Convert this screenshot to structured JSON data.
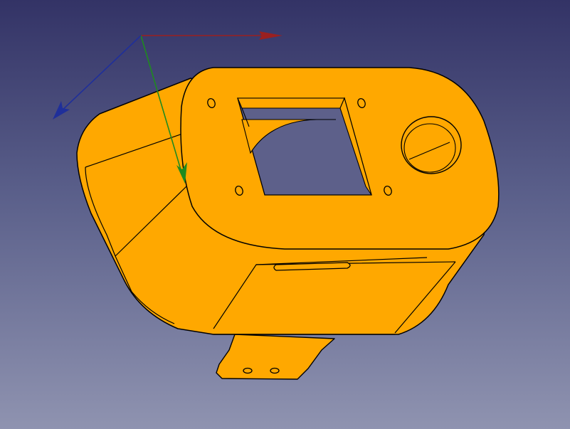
{
  "viewport": {
    "background_top": "#333366",
    "background_bottom": "#8f93b0"
  },
  "model": {
    "body_color": "#FFA800",
    "edge_color": "#000000"
  },
  "axes": {
    "x_color": "#9a2020",
    "y_color": "#1f8a1f",
    "z_color": "#1f2f9a"
  }
}
